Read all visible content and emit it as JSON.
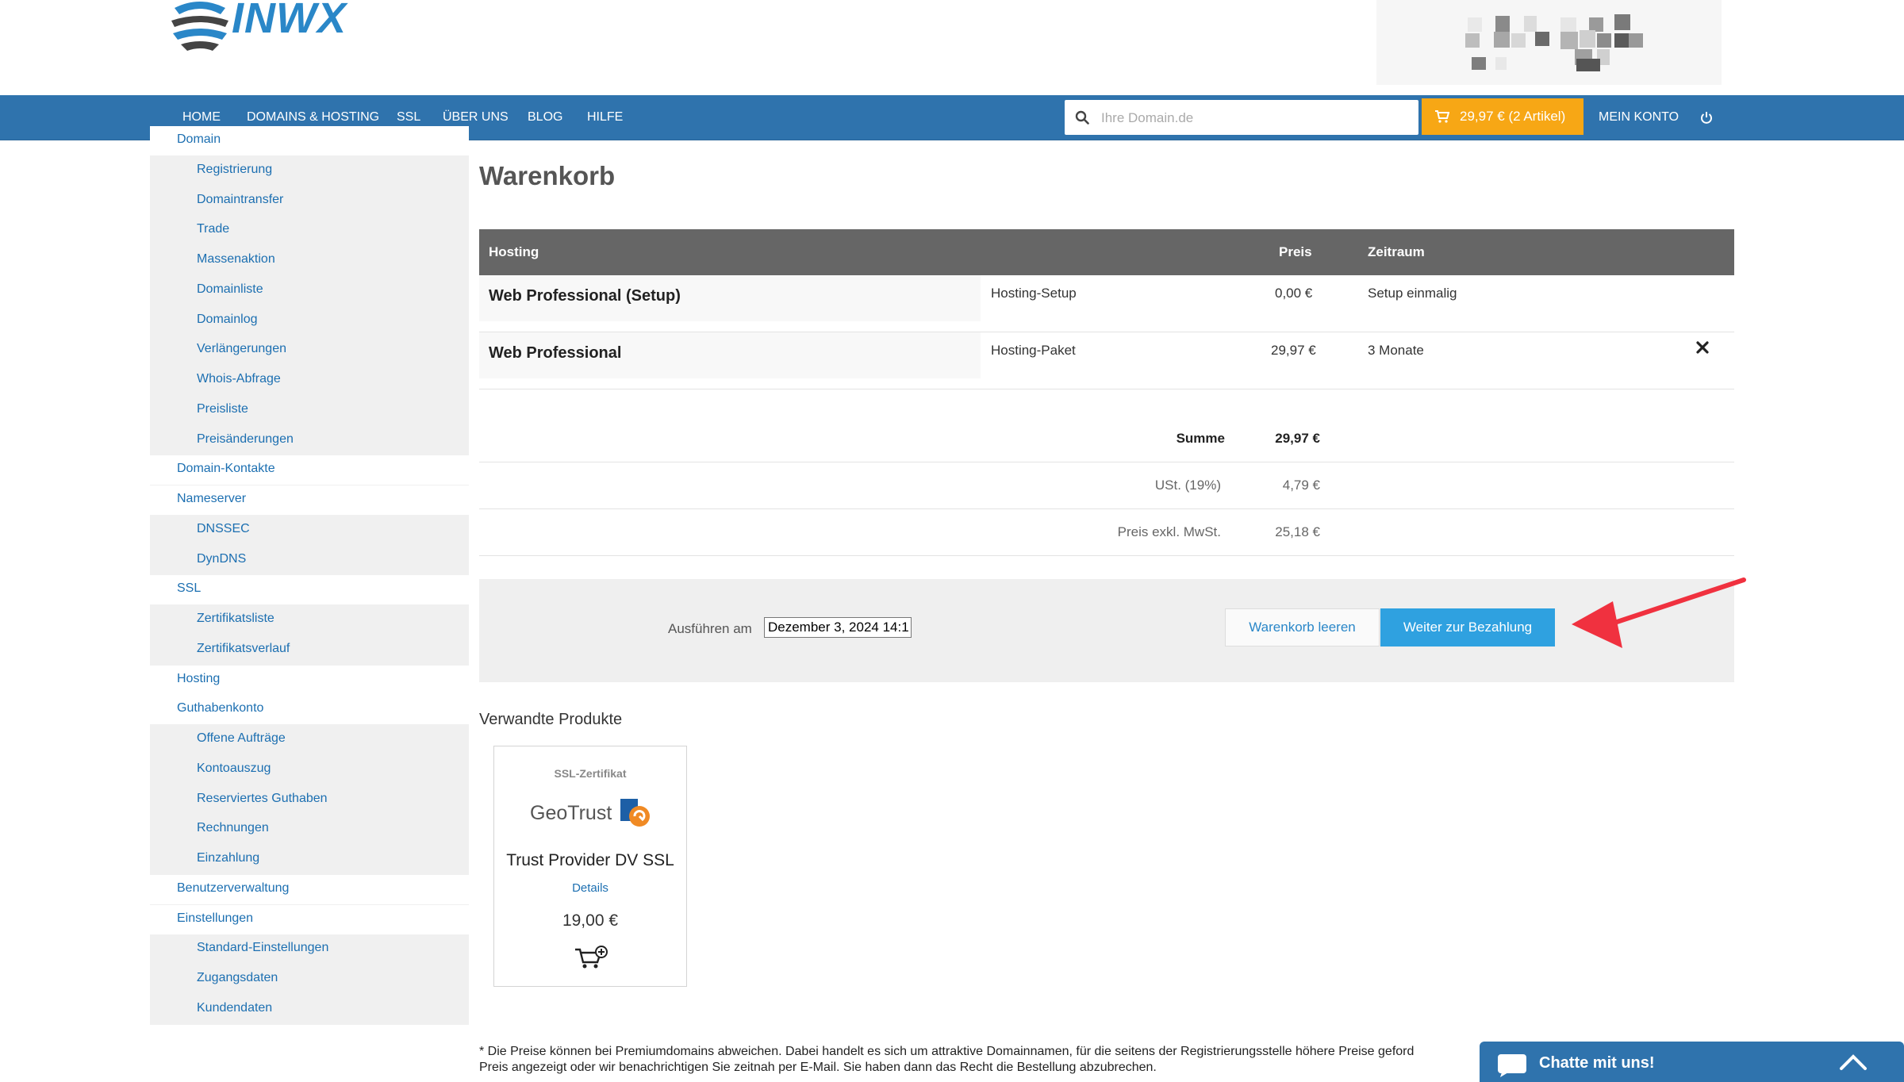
{
  "brand": {
    "name": "INWX",
    "accent": "#2a87c8",
    "nav_bg": "#2f73ad",
    "cart_color": "#f7a715"
  },
  "nav": {
    "items": [
      "HOME",
      "DOMAINS & HOSTING",
      "SSL",
      "ÜBER UNS",
      "BLOG",
      "HILFE"
    ],
    "search_placeholder": "Ihre Domain.de",
    "cart_label": "29,97 € (2 Artikel)",
    "account_label": "MEIN KONTO"
  },
  "sidebar": {
    "items": [
      {
        "label": "Domain",
        "level": "top"
      },
      {
        "label": "Registrierung",
        "level": "sub"
      },
      {
        "label": "Domaintransfer",
        "level": "sub"
      },
      {
        "label": "Trade",
        "level": "sub"
      },
      {
        "label": "Massenaktion",
        "level": "sub"
      },
      {
        "label": "Domainliste",
        "level": "sub"
      },
      {
        "label": "Domainlog",
        "level": "sub"
      },
      {
        "label": "Verlängerungen",
        "level": "sub"
      },
      {
        "label": "Whois-Abfrage",
        "level": "sub"
      },
      {
        "label": "Preisliste",
        "level": "sub"
      },
      {
        "label": "Preisänderungen",
        "level": "sub"
      },
      {
        "label": "Domain-Kontakte",
        "level": "top"
      },
      {
        "label": "Nameserver",
        "level": "top"
      },
      {
        "label": "DNSSEC",
        "level": "sub"
      },
      {
        "label": "DynDNS",
        "level": "sub"
      },
      {
        "label": "SSL",
        "level": "top"
      },
      {
        "label": "Zertifikatsliste",
        "level": "sub"
      },
      {
        "label": "Zertifikatsverlauf",
        "level": "sub"
      },
      {
        "label": "Hosting",
        "level": "top"
      },
      {
        "label": "Guthabenkonto",
        "level": "top"
      },
      {
        "label": "Offene Aufträge",
        "level": "sub"
      },
      {
        "label": "Kontoauszug",
        "level": "sub"
      },
      {
        "label": "Reserviertes Guthaben",
        "level": "sub"
      },
      {
        "label": "Rechnungen",
        "level": "sub"
      },
      {
        "label": "Einzahlung",
        "level": "sub"
      },
      {
        "label": "Benutzerverwaltung",
        "level": "top"
      },
      {
        "label": "Einstellungen",
        "level": "top"
      },
      {
        "label": "Standard-Einstellungen",
        "level": "sub"
      },
      {
        "label": "Zugangsdaten",
        "level": "sub"
      },
      {
        "label": "Kundendaten",
        "level": "sub"
      }
    ]
  },
  "cart": {
    "title": "Warenkorb",
    "headers": {
      "category": "Hosting",
      "price": "Preis",
      "period": "Zeitraum"
    },
    "rows": [
      {
        "name": "Web Professional (Setup)",
        "type": "Hosting-Setup",
        "price": "0,00 €",
        "period": "Setup einmalig"
      },
      {
        "name": "Web Professional",
        "type": "Hosting-Paket",
        "price": "29,97 €",
        "period": "3 Monate"
      }
    ],
    "totals": [
      {
        "label": "Summe",
        "value": "29,97 €",
        "bold": true
      },
      {
        "label": "USt. (19%)",
        "value": "4,79 €",
        "bold": false
      },
      {
        "label": "Preis exkl. MwSt.",
        "value": "25,18 €",
        "bold": false
      }
    ],
    "execute_label": "Ausführen am",
    "execute_value": "Dezember 3, 2024 14:1",
    "clear_label": "Warenkorb leeren",
    "pay_label": "Weiter zur Bezahlung"
  },
  "related": {
    "title": "Verwandte Produkte",
    "product": {
      "category": "SSL-Zertifikat",
      "brand": "GeoTrust",
      "name": "Trust Provider DV SSL",
      "details": "Details",
      "price": "19,00 €"
    }
  },
  "footnote": {
    "line1": "* Die Preise können bei Premiumdomains abweichen. Dabei handelt es sich um attraktive Domainnamen, für die seitens der Registrierungsstelle höhere Preise geford",
    "line2": "Preis angezeigt oder wir benachrichtigen Sie zeitnah per E-Mail. Sie haben dann das Recht die Bestellung abzubrechen."
  },
  "chat": {
    "label": "Chatte mit uns!"
  }
}
